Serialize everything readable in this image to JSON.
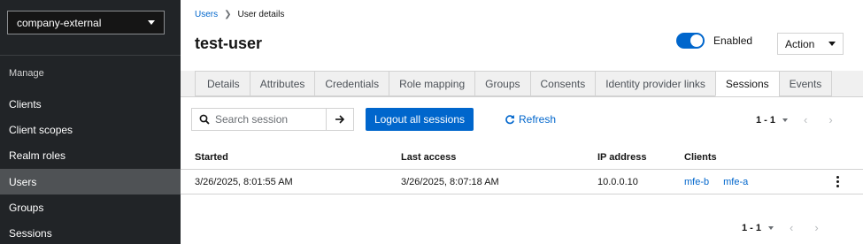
{
  "sidebar": {
    "realm": "company-external",
    "heading": "Manage",
    "items": [
      {
        "label": "Clients"
      },
      {
        "label": "Client scopes"
      },
      {
        "label": "Realm roles"
      },
      {
        "label": "Users",
        "active": true
      },
      {
        "label": "Groups"
      },
      {
        "label": "Sessions"
      }
    ]
  },
  "breadcrumb": {
    "parent": "Users",
    "current": "User details"
  },
  "header": {
    "title": "test-user",
    "enabled_label": "Enabled",
    "enabled": true,
    "action_label": "Action"
  },
  "tabs": [
    {
      "label": "Details"
    },
    {
      "label": "Attributes"
    },
    {
      "label": "Credentials"
    },
    {
      "label": "Role mapping"
    },
    {
      "label": "Groups"
    },
    {
      "label": "Consents"
    },
    {
      "label": "Identity provider links"
    },
    {
      "label": "Sessions",
      "active": true
    },
    {
      "label": "Events"
    }
  ],
  "toolbar": {
    "search_placeholder": "Search session",
    "logout_label": "Logout all sessions",
    "refresh_label": "Refresh",
    "pagination_top": "1 - 1",
    "pagination_bottom": "1 - 1"
  },
  "table": {
    "columns": [
      "Started",
      "Last access",
      "IP address",
      "Clients"
    ],
    "rows": [
      {
        "started": "3/26/2025, 8:01:55 AM",
        "last_access": "3/26/2025, 8:07:18 AM",
        "ip": "10.0.0.10",
        "clients": [
          "mfe-b",
          "mfe-a"
        ]
      }
    ]
  },
  "colors": {
    "primary": "#0066cc",
    "sidebar_bg": "#212427",
    "sidebar_active": "#4f5255"
  }
}
